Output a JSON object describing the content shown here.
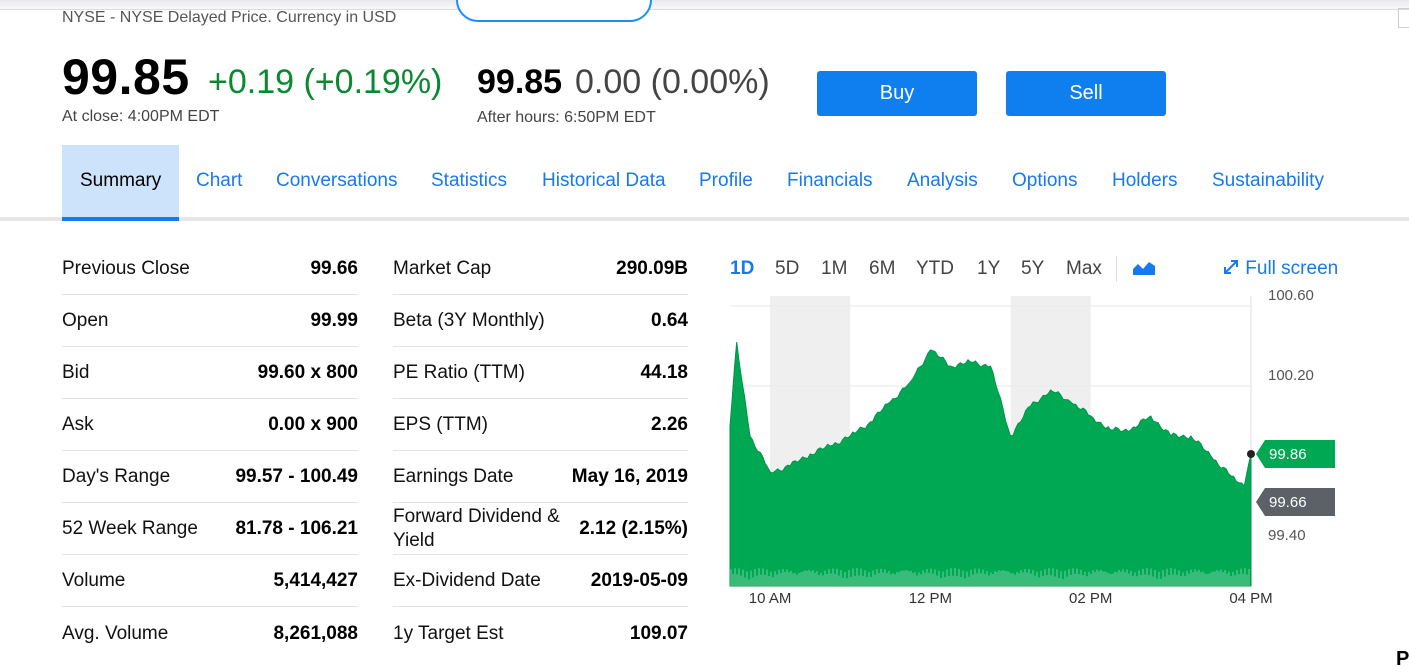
{
  "header": {
    "exchange": "NYSE - NYSE Delayed Price. Currency in USD",
    "price": "99.85",
    "change": "+0.19 (+0.19%)",
    "close_time": "At close: 4:00PM EDT",
    "after_hours_price": "99.85",
    "after_hours_change": "0.00 (0.00%)",
    "after_hours_time": "After hours: 6:50PM EDT",
    "buy_label": "Buy",
    "sell_label": "Sell"
  },
  "tabs": [
    {
      "label": "Summary",
      "active": true
    },
    {
      "label": "Chart"
    },
    {
      "label": "Conversations"
    },
    {
      "label": "Statistics"
    },
    {
      "label": "Historical Data"
    },
    {
      "label": "Profile"
    },
    {
      "label": "Financials"
    },
    {
      "label": "Analysis"
    },
    {
      "label": "Options"
    },
    {
      "label": "Holders"
    },
    {
      "label": "Sustainability"
    }
  ],
  "summary_left": [
    {
      "label": "Previous Close",
      "value": "99.66"
    },
    {
      "label": "Open",
      "value": "99.99"
    },
    {
      "label": "Bid",
      "value": "99.60 x 800"
    },
    {
      "label": "Ask",
      "value": "0.00 x 900"
    },
    {
      "label": "Day's Range",
      "value": "99.57 - 100.49"
    },
    {
      "label": "52 Week Range",
      "value": "81.78 - 106.21"
    },
    {
      "label": "Volume",
      "value": "5,414,427"
    },
    {
      "label": "Avg. Volume",
      "value": "8,261,088"
    }
  ],
  "summary_right": [
    {
      "label": "Market Cap",
      "value": "290.09B"
    },
    {
      "label": "Beta (3Y Monthly)",
      "value": "0.64"
    },
    {
      "label": "PE Ratio (TTM)",
      "value": "44.18"
    },
    {
      "label": "EPS (TTM)",
      "value": "2.26"
    },
    {
      "label": "Earnings Date",
      "value": "May 16, 2019"
    },
    {
      "label": "Forward Dividend & Yield",
      "value": "2.12 (2.15%)"
    },
    {
      "label": "Ex-Dividend Date",
      "value": "2019-05-09"
    },
    {
      "label": "1y Target Est",
      "value": "109.07"
    }
  ],
  "chart_controls": {
    "ranges": [
      "1D",
      "5D",
      "1M",
      "6M",
      "YTD",
      "1Y",
      "5Y",
      "Max"
    ],
    "active_range": "1D",
    "chart_type_icon": "area-chart-icon",
    "fullscreen_label": "Full screen",
    "fullscreen_icon": "expand-icon"
  },
  "chart_data": {
    "type": "area",
    "color": "#00a854",
    "ylim": [
      99.2,
      100.65
    ],
    "y_ticks": [
      "100.60",
      "100.20",
      "99.40"
    ],
    "x_ticks": [
      "10 AM",
      "12 PM",
      "02 PM",
      "04 PM"
    ],
    "current_label": "99.86",
    "current_color": "#00a854",
    "prev_close_label": "99.66",
    "prev_close_color": "#5b6166",
    "x": [
      "9:30",
      "9:35",
      "9:45",
      "10:00",
      "10:15",
      "10:30",
      "10:45",
      "11:00",
      "11:15",
      "11:30",
      "11:45",
      "12:00",
      "12:15",
      "12:30",
      "12:45",
      "13:00",
      "13:15",
      "13:30",
      "13:45",
      "14:00",
      "14:15",
      "14:30",
      "14:45",
      "15:00",
      "15:15",
      "15:30",
      "15:45",
      "15:55",
      "16:00"
    ],
    "values": [
      100.0,
      100.42,
      99.95,
      99.77,
      99.8,
      99.86,
      99.9,
      99.95,
      100.02,
      100.12,
      100.22,
      100.38,
      100.3,
      100.32,
      100.3,
      99.95,
      100.1,
      100.18,
      100.12,
      100.05,
      99.98,
      99.98,
      100.05,
      99.95,
      99.95,
      99.85,
      99.75,
      99.7,
      99.86
    ]
  }
}
